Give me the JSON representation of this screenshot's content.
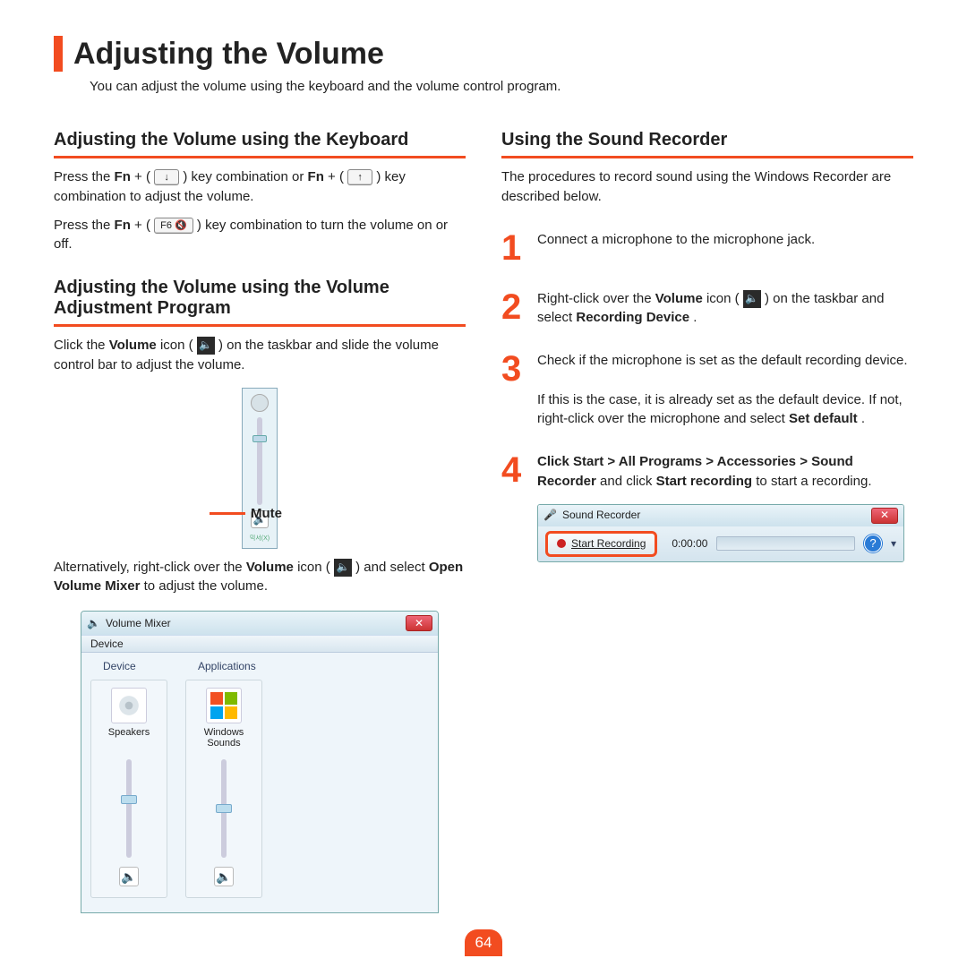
{
  "title": "Adjusting the Volume",
  "intro": "You can adjust the volume using the keyboard and the volume control program.",
  "left": {
    "h2a": "Adjusting the Volume using the Keyboard",
    "p1_a": "Press the ",
    "p1_fn1": "Fn",
    "p1_b": " + (",
    "p1_c": ") key combination or ",
    "p1_fn2": "Fn",
    "p1_d": " + (",
    "p1_e": ") key combination to adjust the volume.",
    "p2_a": "Press the ",
    "p2_fn": "Fn",
    "p2_b": " + (",
    "p2_key": "F6 🔇",
    "p2_c": ") key combination to turn the volume on or off.",
    "h2b": "Adjusting the Volume using the Volume Adjustment Program",
    "p3_a": "Click the ",
    "p3_vol": "Volume",
    "p3_b": " icon (",
    "p3_c": ") on the taskbar and slide the volume control bar to adjust the volume.",
    "mute_label": "Mute",
    "p4_a": "Alternatively, right-click over the ",
    "p4_vol": "Volume",
    "p4_b": " icon (",
    "p4_c": ") and select ",
    "p4_ovm": "Open Volume Mixer",
    "p4_d": " to adjust the volume.",
    "mixer": {
      "title": "Volume Mixer",
      "menu": "Device",
      "device_header": "Device",
      "apps_header": "Applications",
      "speakers": "Speakers",
      "winsounds": "Windows Sounds"
    }
  },
  "right": {
    "h2": "Using the Sound Recorder",
    "intro": "The procedures to record sound using the Windows Recorder are described below.",
    "step1": "Connect a microphone to the microphone jack.",
    "step2_a": "Right-click over the ",
    "step2_vol": "Volume",
    "step2_b": " icon (",
    "step2_c": ") on the taskbar and select ",
    "step2_rd": "Recording Device",
    "step2_d": ".",
    "step3_a": "Check if the microphone is set as the default recording device.",
    "step3_b": "If this is the case, it is already set as the default device. If not, right-click over the microphone and select ",
    "step3_sd": "Set default",
    "step3_c": ".",
    "step4_a": "Click Start > All Programs > Accessories > Sound Recorder",
    "step4_b": " and click ",
    "step4_sr": "Start recording",
    "step4_c": " to start a recording.",
    "sr": {
      "title": "Sound Recorder",
      "start": "Start Recording",
      "time": "0:00:00"
    },
    "nums": {
      "n1": "1",
      "n2": "2",
      "n3": "3",
      "n4": "4"
    }
  },
  "page": "64",
  "key_up": "↑",
  "key_down": "↓",
  "speaker_glyph": "🔈",
  "mic_glyph": "🎤",
  "help_glyph": "?",
  "drop_glyph": "▾",
  "close_glyph": "✕"
}
